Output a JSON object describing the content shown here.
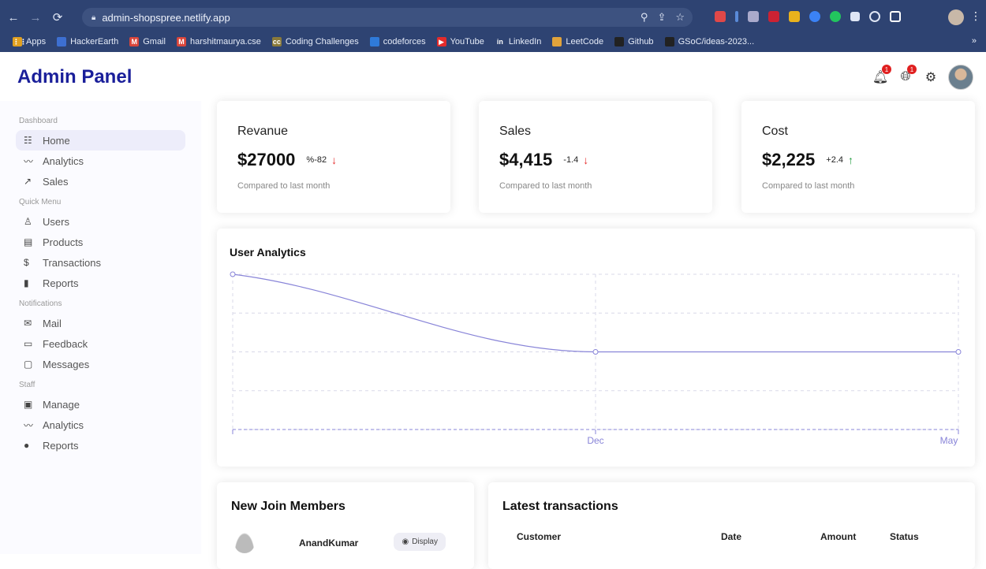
{
  "browser": {
    "url": "admin-shopspree.netlify.app",
    "bookmarks": [
      {
        "label": "Apps",
        "color": "#e0a020",
        "glyph": "⋮⋮"
      },
      {
        "label": "HackerEarth",
        "color": "#3d6fd1",
        "glyph": ""
      },
      {
        "label": "Gmail",
        "color": "#d9463b",
        "glyph": "M"
      },
      {
        "label": "harshitmaurya.cse",
        "color": "#d9463b",
        "glyph": "M"
      },
      {
        "label": "Coding Challenges",
        "color": "#8a7a3a",
        "glyph": "cc"
      },
      {
        "label": "codeforces",
        "color": "#2f7ad9",
        "glyph": ""
      },
      {
        "label": "YouTube",
        "color": "#e42b2b",
        "glyph": "▶"
      },
      {
        "label": "LinkedIn",
        "color": "#2e4372",
        "glyph": "in"
      },
      {
        "label": "LeetCode",
        "color": "#e1a33b",
        "glyph": ""
      },
      {
        "label": "Github",
        "color": "#222222",
        "glyph": ""
      },
      {
        "label": "GSoC/ideas-2023...",
        "color": "#222222",
        "glyph": ""
      }
    ],
    "more": "»"
  },
  "header": {
    "title": "Admin Panel",
    "notif_badge": "1",
    "language_badge": "1"
  },
  "sidebar": {
    "sections": [
      {
        "title": "Dashboard",
        "items": [
          {
            "label": "Home",
            "icon": "home-icon",
            "glyph": "☷",
            "active": true
          },
          {
            "label": "Analytics",
            "icon": "analytics-icon",
            "glyph": "〰",
            "active": false
          },
          {
            "label": "Sales",
            "icon": "trending-up-icon",
            "glyph": "↗",
            "active": false
          }
        ]
      },
      {
        "title": "Quick Menu",
        "items": [
          {
            "label": "Users",
            "icon": "user-icon",
            "glyph": "♙",
            "active": false
          },
          {
            "label": "Products",
            "icon": "storefront-icon",
            "glyph": "▤",
            "active": false
          },
          {
            "label": "Transactions",
            "icon": "dollar-icon",
            "glyph": "$",
            "active": false
          },
          {
            "label": "Reports",
            "icon": "bar-chart-icon",
            "glyph": "▮",
            "active": false
          }
        ]
      },
      {
        "title": "Notifications",
        "items": [
          {
            "label": "Mail",
            "icon": "mail-icon",
            "glyph": "✉",
            "active": false
          },
          {
            "label": "Feedback",
            "icon": "feedback-icon",
            "glyph": "▭",
            "active": false
          },
          {
            "label": "Messages",
            "icon": "message-icon",
            "glyph": "▢",
            "active": false
          }
        ]
      },
      {
        "title": "Staff",
        "items": [
          {
            "label": "Manage",
            "icon": "briefcase-icon",
            "glyph": "▣",
            "active": false
          },
          {
            "label": "Analytics",
            "icon": "analytics-icon",
            "glyph": "〰",
            "active": false
          },
          {
            "label": "Reports",
            "icon": "report-icon",
            "glyph": "●",
            "active": false
          }
        ]
      }
    ]
  },
  "kpis": [
    {
      "title": "Revanue",
      "value": "$27000",
      "rate": "%-82",
      "direction": "down",
      "sub": "Compared to last month"
    },
    {
      "title": "Sales",
      "value": "$4,415",
      "rate": "-1.4",
      "direction": "down",
      "sub": "Compared to last month"
    },
    {
      "title": "Cost",
      "value": "$2,225",
      "rate": "+2.4",
      "direction": "up",
      "sub": "Compared to last month"
    }
  ],
  "chart_data": {
    "type": "line",
    "title": "User Analytics",
    "categories": [
      "",
      "Dec",
      "May"
    ],
    "series": [
      {
        "values": [
          4,
          2,
          2
        ]
      }
    ],
    "ylim": [
      0,
      4
    ],
    "grid": true,
    "line_color": "#8884d8"
  },
  "members": {
    "title": "New Join Members",
    "items": [
      {
        "name": "AnandKumar",
        "action": "Display"
      }
    ]
  },
  "transactions": {
    "title": "Latest transactions",
    "columns": [
      "Customer",
      "Date",
      "Amount",
      "Status"
    ]
  }
}
